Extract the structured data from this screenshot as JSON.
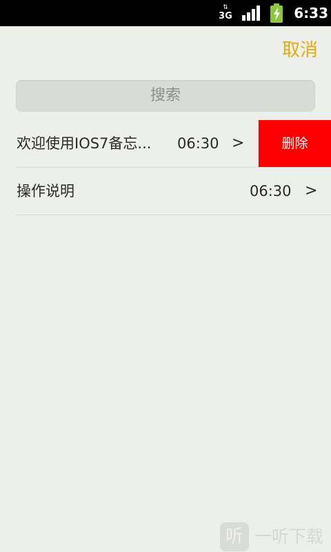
{
  "status_bar": {
    "network_type": "3G",
    "network_arrows": "⇅",
    "time": "6:33"
  },
  "header": {
    "cancel_label": "取消"
  },
  "search": {
    "placeholder": "搜索"
  },
  "notes": [
    {
      "title": "欢迎使用IOS7备忘...",
      "time": "06:30",
      "chevron": ">",
      "swiped": true
    },
    {
      "title": "操作说明",
      "time": "06:30",
      "chevron": ">",
      "swiped": false
    }
  ],
  "row_actions": {
    "delete_label": "删除",
    "delete_color": "#ff0000"
  },
  "watermark": {
    "logo_glyph": "听",
    "text": "一听下载"
  },
  "colors": {
    "accent": "#e3aa12",
    "background": "#edefea",
    "battery": "#8dc63f"
  }
}
